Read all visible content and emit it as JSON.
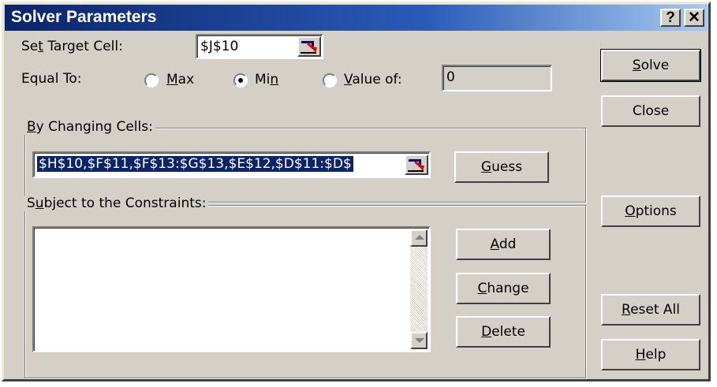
{
  "window": {
    "title": "Solver Parameters",
    "help_label": "?",
    "close_label": "✕"
  },
  "target": {
    "label_pre": "Se",
    "label_key": "t",
    "label_post": " Target Cell:",
    "value": "$J$10"
  },
  "equal_to": {
    "label": "Equal To:",
    "max": {
      "key": "M",
      "rest": "ax",
      "selected": false
    },
    "min": {
      "pre": "Mi",
      "key": "n",
      "selected": true
    },
    "value_of": {
      "key": "V",
      "rest": "alue of:",
      "selected": false,
      "value": "0"
    }
  },
  "changing": {
    "group_label_key": "B",
    "group_label_rest": "y Changing Cells:",
    "value": "$H$10,$F$11,$F$13:$G$13,$E$12,$D$11:$D$",
    "guess": {
      "key": "G",
      "rest": "uess"
    }
  },
  "constraints": {
    "group_label_pre": "S",
    "group_label_key": "u",
    "group_label_rest": "bject to the Constraints:",
    "add": {
      "key": "A",
      "rest": "dd"
    },
    "change": {
      "key": "C",
      "rest": "hange"
    },
    "delete": {
      "key": "D",
      "rest": "elete"
    }
  },
  "side_buttons": {
    "solve": {
      "key": "S",
      "rest": "olve"
    },
    "close": {
      "label": "Close"
    },
    "options": {
      "key": "O",
      "rest": "ptions"
    },
    "reset": {
      "key": "R",
      "rest": "eset All"
    },
    "help": {
      "key": "H",
      "rest": "elp"
    }
  },
  "colors": {
    "title_start": "#0a246a",
    "title_end": "#a6caf0",
    "face": "#d4d0c8",
    "selection": "#0a246a"
  }
}
